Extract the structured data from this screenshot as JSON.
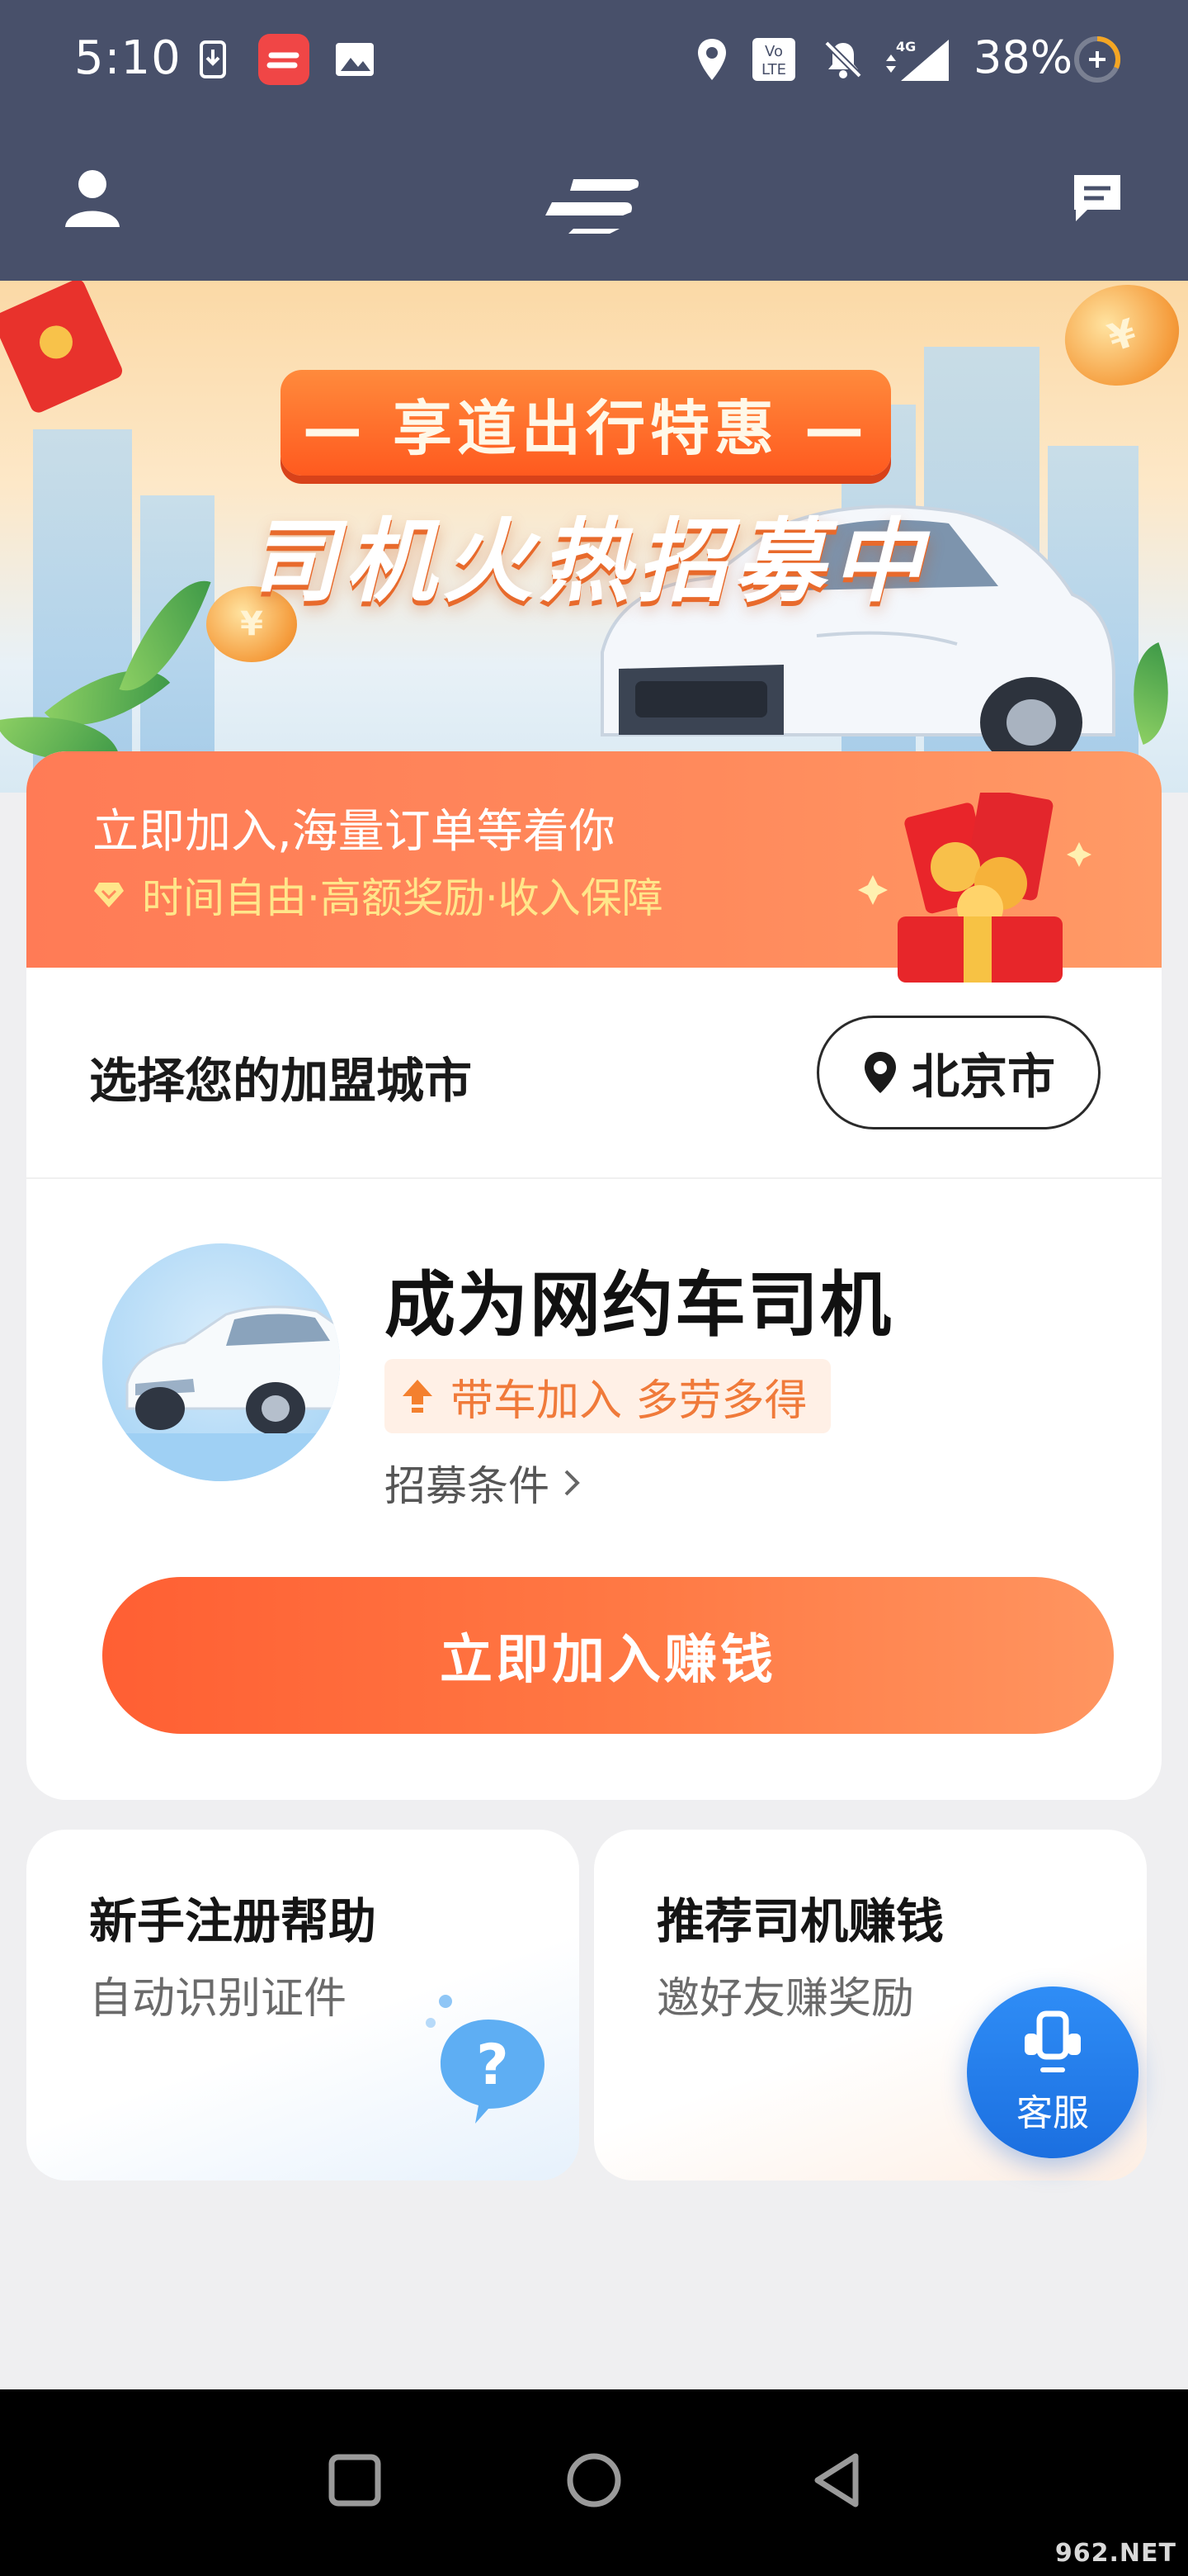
{
  "status_bar": {
    "time": "5:10",
    "volte": "Vo LTE",
    "network": "4G",
    "battery": "38%"
  },
  "app_bar": {
    "profile_icon": "person-icon",
    "logo_icon": "app-logo-icon",
    "message_icon": "chat-icon"
  },
  "banner": {
    "ribbon": "— 享道出行特惠 —",
    "title": "司机火热招募中"
  },
  "join_card": {
    "headline": "立即加入,海量订单等着你",
    "benefits": "时间自由·高额奖励·收入保障",
    "city_label": "选择您的加盟城市",
    "city_value": "北京市",
    "driver_title": "成为网约车司机",
    "driver_tag": "带车加入 多劳多得",
    "requirements_link": "招募条件",
    "join_button": "立即加入赚钱"
  },
  "help_card": {
    "title": "新手注册帮助",
    "subtitle": "自动识别证件"
  },
  "refer_card": {
    "title": "推荐司机赚钱",
    "subtitle": "邀好友赚奖励"
  },
  "customer_service": {
    "label": "客服"
  },
  "watermark": "962.NET",
  "colors": {
    "header_bg": "#48506a",
    "accent_orange": "#ff6a3d",
    "cs_blue": "#2f8df6"
  }
}
